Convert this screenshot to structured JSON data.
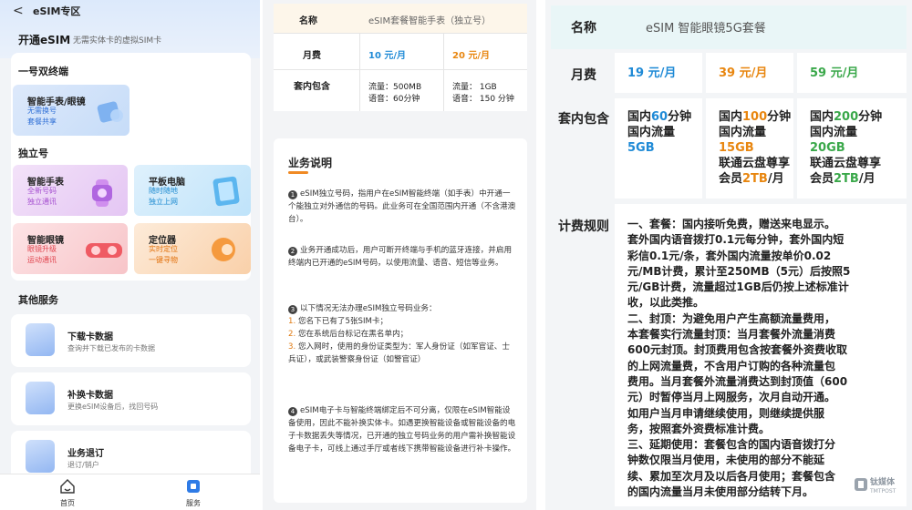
{
  "app": {
    "back_label": "<",
    "nav_title": "eSIM专区",
    "open_title": "开通eSIM",
    "open_subtitle": "无需实体卡的虚拟SIM卡",
    "section_dual": "一号双终端",
    "card_watch_glasses": {
      "title": "智能手表/眼镜",
      "sub1": "无需换号",
      "sub2": "套餐共享"
    },
    "section_independent": "独立号",
    "card_watch": {
      "title": "智能手表",
      "sub1": "全新号码",
      "sub2": "独立通讯"
    },
    "card_tablet": {
      "title": "平板电脑",
      "sub1": "随时随地",
      "sub2": "独立上网"
    },
    "card_glasses": {
      "title": "智能眼镜",
      "sub1": "眼镜升级",
      "sub2": "运动通讯"
    },
    "card_locator": {
      "title": "定位器",
      "sub1": "实时定位",
      "sub2": "一键寻物"
    },
    "section_other": "其他服务",
    "services": [
      {
        "title": "下载卡数据",
        "sub": "查询并下载已发布的卡数据",
        "icon": "download-icon"
      },
      {
        "title": "补换卡数据",
        "sub": "更换eSIM设备后，找回号码",
        "icon": "card-replace-icon"
      },
      {
        "title": "业务退订",
        "sub": "退订/销户",
        "icon": "document-icon"
      }
    ],
    "tabs": [
      {
        "label": "首页",
        "icon": "home-icon"
      },
      {
        "label": "服务",
        "icon": "service-icon"
      }
    ]
  },
  "watch_plan": {
    "name_label": "名称",
    "name_value": "eSIM套餐智能手表（独立号）",
    "fee_label": "月费",
    "fee_a": "10 元/月",
    "fee_b": "20 元/月",
    "incl_label": "套内包含",
    "a_data": "流量：500MB",
    "a_voice": "语音：60分钟",
    "b_data": "流量：   1GB",
    "b_voice": "语音：  150 分钟",
    "desc_title": "业务说明",
    "p1_num": "1",
    "p1_text": "eSIM独立号码，指用户在eSIM智能终端（如手表）中开通一个能独立对外通信的号码。此业务可在全国范围内开通（不含港澳台）。",
    "p2_num": "2",
    "p2_text": "业务开通成功后，用户可断开终端与手机的蓝牙连接，并启用终端内已开通的eSIM号码，以使用流量、语音、短信等业务。",
    "p3_num": "3",
    "p3_text": "以下情况无法办理eSIM独立号码业务：",
    "p3_items": [
      {
        "n": "1.",
        "t": "您名下已有了5张SIM卡；"
      },
      {
        "n": "2.",
        "t": "您在系统后台标记在黑名单内；"
      },
      {
        "n": "3.",
        "t": "您入网时，使用的身份证类型为：军人身份证（如军官证、士兵证），或武装警察身份证（如警官证）"
      }
    ],
    "p4_num": "4",
    "p4_text": "eSIM电子卡与智能终端绑定后不可分离，仅限在eSIM智能设备使用，因此不能补换实体卡。如遇更换智能设备或智能设备的电子卡数据丢失等情况，已开通的独立号码业务的用户需补换智能设备电子卡，可线上通过手厅或者线下携带智能设备进行补卡操作。"
  },
  "glasses_plan": {
    "name_label": "名称",
    "name_value": "eSIM 智能眼镜5G套餐",
    "fee_label": "月费",
    "fees": [
      {
        "num": "19",
        "unit": " 元/月"
      },
      {
        "num": "39",
        "unit": " 元/月"
      },
      {
        "num": "59",
        "unit": " 元/月"
      }
    ],
    "incl_label": "套内包含",
    "plans": [
      {
        "l1a": "国内",
        "l1n": "60",
        "l1b": "分钟",
        "l2": "国内流量",
        "l3": "5GB",
        "l4": "",
        "l5": ""
      },
      {
        "l1a": "国内",
        "l1n": "100",
        "l1b": "分钟",
        "l2": "国内流量",
        "l3": "15GB",
        "l4": "联通云盘尊享",
        "l5a": "会员",
        "l5n": "2TB",
        "l5b": "/月"
      },
      {
        "l1a": "国内",
        "l1n": "200",
        "l1b": "分钟",
        "l2": "国内流量",
        "l3": "20GB",
        "l4": "联通云盘尊享",
        "l5a": "会员",
        "l5n": "2TB",
        "l5b": "/月"
      }
    ],
    "rules_label": "计费规则",
    "rules_lines": [
      "一、套餐：国内接听免费，赠送来电显示。",
      "套外国内语音拨打0.1元每分钟，套外国内短",
      "彩信0.1元/条，套外国内流量按单价0.02",
      "元/MB计费，累计至250MB（5元）后按照5",
      "元/GB计费，流量超过1GB后仍按上述标准计",
      "收，以此类推。",
      "二、封顶：为避免用户产生高额流量费用，",
      "本套餐实行流量封顶：当月套餐外流量消费",
      "600元封顶。封顶费用包含按套餐外资费收取",
      "的上网流量费，不含用户订购的各种流量包",
      "费用。当月套餐外流量消费达到封顶值（600",
      "元）时暂停当月上网服务，次月自动开通。",
      "如用户当月申请继续使用，则继续提供服",
      "务，按照套外资费标准计费。",
      "三、延期使用：套餐包含的国内语音拨打分",
      "钟数仅限当月使用，未使用的部分不能延",
      "续、累加至次月及以后各月使用；套餐包含",
      "的国内流量当月未使用部分结转下月。"
    ],
    "watermark": "钛媒体",
    "watermark_sub": "TMTPOST"
  },
  "colors": {
    "blue": "#1f8ad6",
    "orange": "#e8860f",
    "green": "#3aa84a",
    "accent_orange": "#f08a24"
  }
}
